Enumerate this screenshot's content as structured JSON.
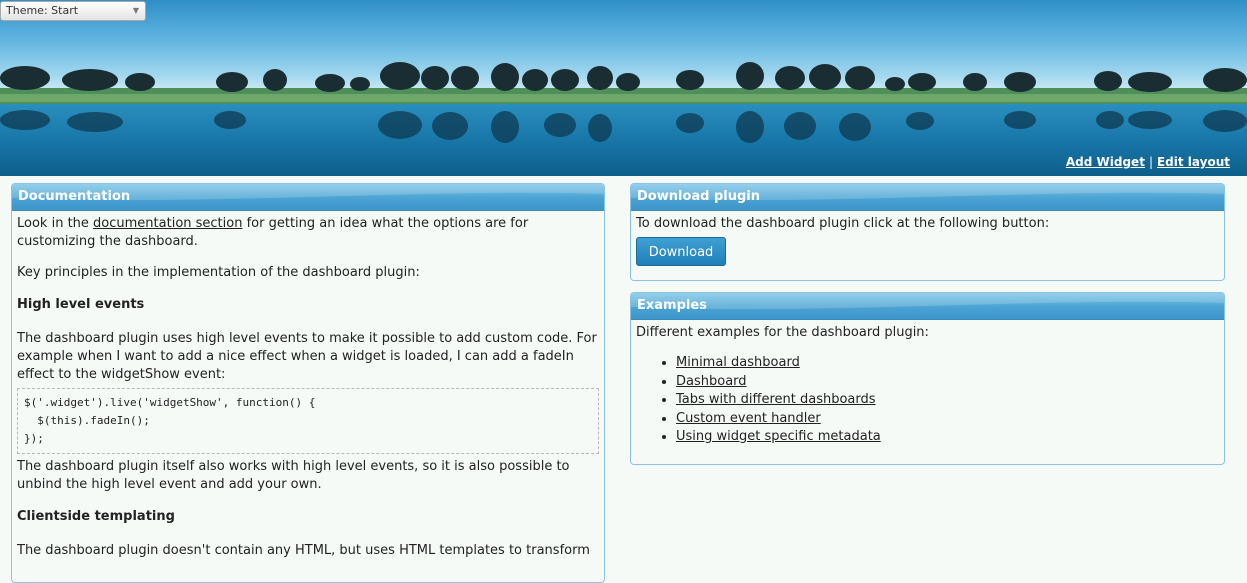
{
  "theme": {
    "label": "Theme:",
    "value": "Start"
  },
  "header": {
    "add_widget": "Add Widget",
    "separator": "|",
    "edit_layout": "Edit layout"
  },
  "documentation": {
    "title": "Documentation",
    "intro_prefix": "Look in the ",
    "intro_link": "documentation section",
    "intro_suffix": " for getting an idea what the options are for customizing the dashboard.",
    "principles": "Key principles in the implementation of the dashboard plugin:",
    "section1_title": "High level events",
    "section1_text": "The dashboard plugin uses high level events to make it possible to add custom code. For example when I want to add a nice effect when a widget is loaded, I can add a fadeIn effect to the widgetShow event:",
    "code": "$('.widget').live('widgetShow', function() {\n  $(this).fadeIn();\n});",
    "section1_after": "The dashboard plugin itself also works with high level events, so it is also possible to unbind the high level event and add your own.",
    "section2_title": "Clientside templating",
    "section2_text": "The dashboard plugin doesn't contain any HTML, but uses HTML templates to transform"
  },
  "download": {
    "title": "Download plugin",
    "text": "To download the dashboard plugin click at the following button:",
    "button": "Download"
  },
  "examples": {
    "title": "Examples",
    "text": "Different examples for the dashboard plugin:",
    "items": [
      "Minimal dashboard",
      "Dashboard",
      "Tabs with different dashboards",
      "Custom event handler",
      "Using widget specific metadata"
    ]
  }
}
